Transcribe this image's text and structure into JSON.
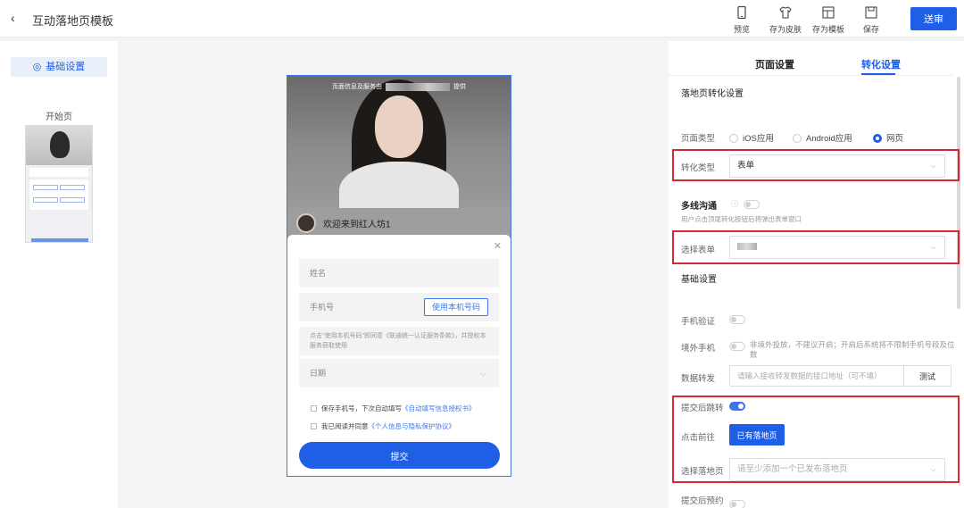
{
  "header": {
    "back_icon": "chevron-left-icon",
    "title": "互动落地页模板",
    "tools": [
      {
        "icon": "phone-icon",
        "label": "预览"
      },
      {
        "icon": "shirt-icon",
        "label": "存为皮肤"
      },
      {
        "icon": "template-icon",
        "label": "存为模板"
      },
      {
        "icon": "floppy-icon",
        "label": "保存"
      }
    ],
    "submit_label": "送审"
  },
  "left": {
    "base_tab": "基础设置",
    "start_page_label": "开始页"
  },
  "preview": {
    "caption_before": "页面信息及服务由",
    "caption_after": "提供",
    "greeting": "欢迎来到红人坊1",
    "form": {
      "name_placeholder": "姓名",
      "phone_placeholder": "手机号",
      "use_phone_btn": "使用本机号码",
      "hint": "点击\"使用本机号码\"即同意《联通统一认证服务条款》，并授权本服务获取使用",
      "date_placeholder": "日期",
      "save_phone_text": "保存手机号，下次自动填写",
      "save_phone_link": "《自动填写信息授权书》",
      "agree_text": "我已阅读并同意",
      "agree_link": "《个人信息与隐私保护协议》",
      "submit": "提交"
    }
  },
  "settings": {
    "tabs": [
      "页面设置",
      "转化设置"
    ],
    "active_tab": 1,
    "section_title": "落地页转化设置",
    "page_type_label": "页面类型",
    "page_type_options": [
      "iOS应用",
      "Android应用",
      "网页"
    ],
    "page_type_selected": 2,
    "conv_type_label": "转化类型",
    "conv_type_value": "表单",
    "multiline_label": "多线沟通",
    "multiline_on": false,
    "multiline_sub": "用户点击顶尾转化按钮后将弹出表单窗口",
    "select_form_label": "选择表单",
    "basic_title": "基础设置",
    "phone_verify_label": "手机验证",
    "phone_verify_on": false,
    "outside_phone_label": "境外手机",
    "outside_phone_on": false,
    "outside_phone_note": "非境外投放，不建议开启；开启后系统将不限制手机号段及位数",
    "data_forward_label": "数据转发",
    "data_forward_placeholder": "请输入接收转发数据的接口地址（可不填）",
    "test_btn": "测试",
    "jump_label": "提交后跳转",
    "jump_on": true,
    "goto_label": "点击前往",
    "goto_btn": "已有落地页",
    "choose_lp_label": "选择落地页",
    "choose_lp_placeholder": "请至少添加一个已发布落地页",
    "book_label": "提交后预约",
    "book_on": false
  },
  "colors": {
    "accent": "#1f5fe6",
    "highlight_border": "#d9262f"
  }
}
